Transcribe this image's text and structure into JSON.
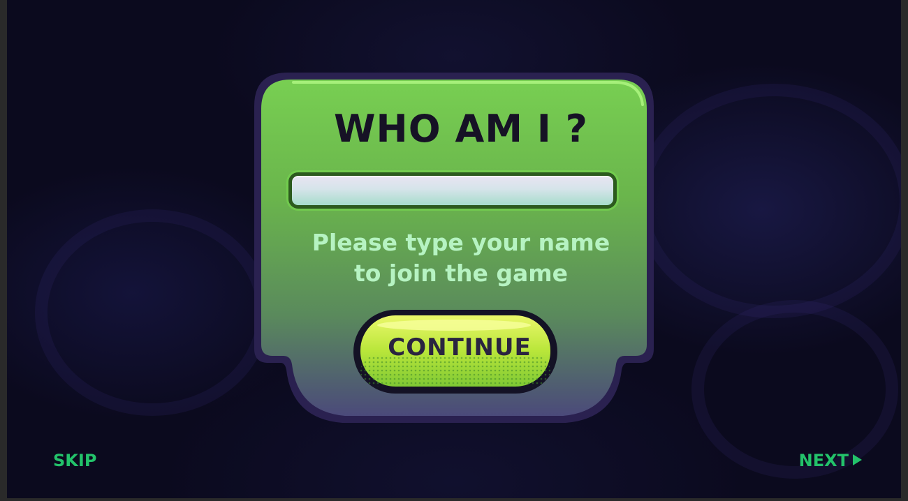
{
  "dialog": {
    "title": "WHO AM I ?",
    "name_input_value": "",
    "instruction_line1": "Please type your name",
    "instruction_line2": "to join the game",
    "continue_label": "CONTINUE"
  },
  "footer": {
    "skip_label": "SKIP",
    "next_label": "NEXT"
  },
  "icons": {
    "next": "play-triangle-icon"
  },
  "colors": {
    "background": "#0b0a1e",
    "panel_top": "#71c84f",
    "panel_bottom": "#4a4a7c",
    "title_text": "#161225",
    "instruction_text": "#b6f3c2",
    "button_fill": "#b9e63a",
    "nav_text": "#23c26a"
  }
}
